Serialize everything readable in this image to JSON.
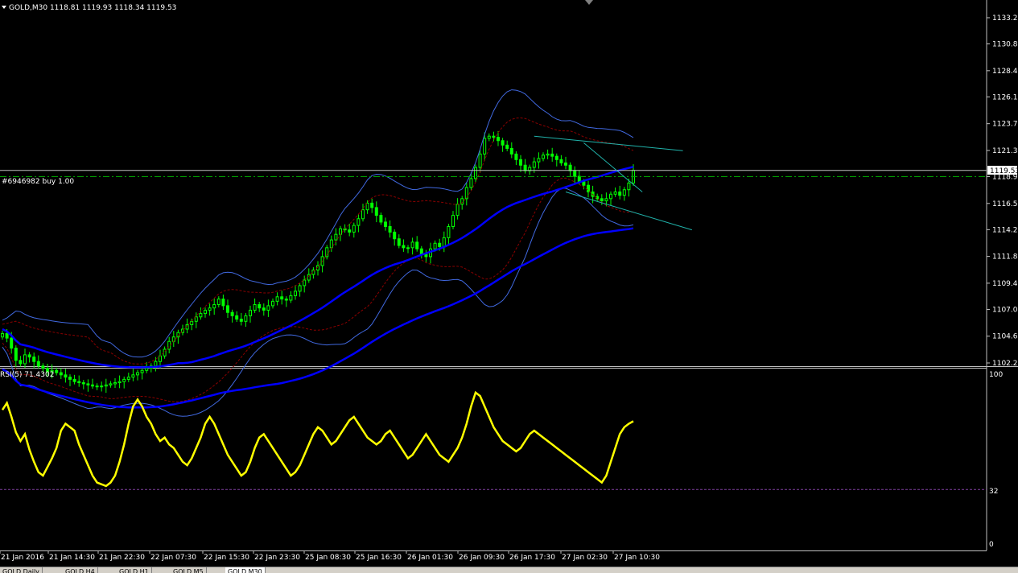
{
  "main_panel": {
    "header": "GOLD,M30  1118.81 1119.93 1118.34 1119.53",
    "current_price": "1119.53",
    "order_label": "#6946982 buy 1.00",
    "order_price_label": "1118.97",
    "colors": {
      "candles": "#00ff00",
      "ma": "#0000ff",
      "bands": "#4169e1",
      "envelope": "#8b0000",
      "trendline": "#20b2aa",
      "order_line": "#00a000",
      "price_line": "#c0c0c0"
    }
  },
  "rsi_panel": {
    "header": "RSI(5) 71.4302",
    "level_label": "32",
    "top_label": "100",
    "bottom_label": "0",
    "colors": {
      "line": "#ffff00",
      "level": "#8040a0"
    }
  },
  "tabs": [
    "GOLD,Daily",
    "GOLD,H4",
    "GOLD,H1",
    "GOLD,M5",
    "GOLD,M30"
  ],
  "chart_data": [
    {
      "type": "candlestick",
      "title": "GOLD,M30  1118.81 1119.93 1118.34 1119.53",
      "ylim": [
        1102.27,
        1133.22
      ],
      "y_ticks": [
        "1133.22",
        "1130.87",
        "1128.47",
        "1126.12",
        "1123.72",
        "1121.32",
        "1118.97",
        "1116.57",
        "1114.22",
        "1111.82",
        "1109.42",
        "1107.07",
        "1104.67",
        "1102.27"
      ],
      "x_ticks": [
        "21 Jan 2016",
        "21 Jan 14:30",
        "21 Jan 22:30",
        "22 Jan 07:30",
        "22 Jan 15:30",
        "22 Jan 23:30",
        "25 Jan 08:30",
        "25 Jan 16:30",
        "26 Jan 01:30",
        "26 Jan 09:30",
        "26 Jan 17:30",
        "27 Jan 02:30",
        "27 Jan 10:30"
      ],
      "x_tick_pos": [
        0,
        60,
        122,
        186,
        252,
        315,
        378,
        441,
        505,
        569,
        632,
        697,
        762
      ],
      "close": [
        1104.9,
        1104.5,
        1103.6,
        1102.5,
        1102.2,
        1103.0,
        1102.8,
        1102.4,
        1102.0,
        1101.8,
        1101.5,
        1101.6,
        1101.4,
        1101.2,
        1101.0,
        1100.8,
        1100.6,
        1100.5,
        1100.4,
        1100.3,
        1100.2,
        1100.2,
        1100.2,
        1100.3,
        1100.4,
        1100.5,
        1100.6,
        1100.8,
        1101.0,
        1101.2,
        1101.4,
        1101.6,
        1101.8,
        1102.0,
        1102.4,
        1102.9,
        1103.5,
        1104.2,
        1104.6,
        1105.0,
        1105.3,
        1105.7,
        1106.0,
        1106.4,
        1106.7,
        1107.0,
        1107.2,
        1107.5,
        1108.0,
        1107.4,
        1106.8,
        1106.5,
        1106.2,
        1106.0,
        1106.5,
        1107.0,
        1107.5,
        1107.2,
        1107.0,
        1107.4,
        1107.8,
        1108.2,
        1108.0,
        1107.9,
        1108.3,
        1108.7,
        1109.2,
        1109.7,
        1110.2,
        1110.6,
        1111.0,
        1111.8,
        1112.6,
        1113.3,
        1113.8,
        1114.3,
        1114.2,
        1114.0,
        1114.6,
        1115.2,
        1116.0,
        1116.6,
        1116.2,
        1115.5,
        1114.9,
        1114.5,
        1114.0,
        1113.4,
        1112.8,
        1112.6,
        1112.6,
        1113.1,
        1112.5,
        1112.0,
        1111.8,
        1112.5,
        1113.0,
        1112.7,
        1113.5,
        1114.5,
        1115.5,
        1116.5,
        1117.0,
        1118.0,
        1118.8,
        1119.8,
        1121.0,
        1122.4,
        1122.6,
        1122.5,
        1122.2,
        1121.8,
        1121.5,
        1121.0,
        1120.5,
        1120.0,
        1119.5,
        1119.8,
        1120.3,
        1120.6,
        1120.9,
        1121.0,
        1120.8,
        1120.5,
        1120.2,
        1120.0,
        1119.5,
        1119.0,
        1118.5,
        1118.2,
        1117.6,
        1117.2,
        1117.0,
        1116.8,
        1117.0,
        1117.4,
        1117.6,
        1117.3,
        1117.8,
        1118.4,
        1119.53
      ],
      "rsi": [
        78,
        82,
        74,
        65,
        60,
        64,
        55,
        48,
        42,
        40,
        45,
        50,
        56,
        66,
        70,
        68,
        66,
        58,
        52,
        46,
        40,
        36,
        35,
        34,
        36,
        40,
        48,
        58,
        70,
        80,
        84,
        80,
        74,
        70,
        64,
        60,
        62,
        58,
        56,
        52,
        48,
        46,
        50,
        56,
        62,
        70,
        74,
        70,
        64,
        58,
        52,
        48,
        44,
        40,
        42,
        48,
        56,
        62,
        64,
        60,
        56,
        52,
        48,
        44,
        40,
        42,
        46,
        52,
        58,
        64,
        68,
        66,
        62,
        58,
        60,
        64,
        68,
        72,
        74,
        70,
        66,
        62,
        60,
        58,
        60,
        64,
        66,
        62,
        58,
        54,
        50,
        52,
        56,
        60,
        64,
        60,
        56,
        52,
        50,
        48,
        52,
        56,
        62,
        70,
        80,
        88,
        86,
        80,
        74,
        68,
        64,
        60,
        58,
        56,
        54,
        56,
        60,
        64,
        66,
        64,
        62,
        60,
        58,
        56,
        54,
        52,
        50,
        48,
        46,
        44,
        42,
        40,
        38,
        36,
        40,
        48,
        56,
        64,
        68,
        70,
        71.43
      ]
    }
  ]
}
